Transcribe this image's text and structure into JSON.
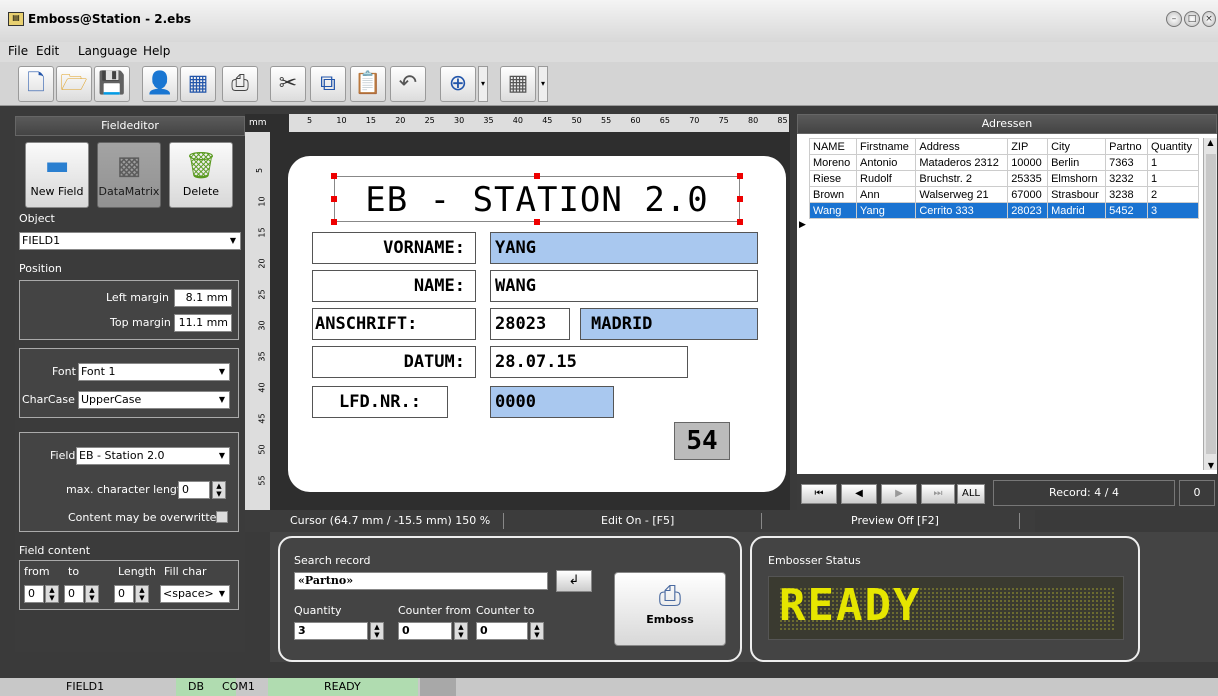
{
  "window": {
    "title": "Emboss@Station - 2.ebs"
  },
  "menu": [
    "File",
    "Edit",
    "Language",
    "Help"
  ],
  "toolbar": {
    "icons": [
      "new-file-icon",
      "open-folder-icon",
      "save-icon",
      "user-settings-icon",
      "preview-icon",
      "print-icon",
      "cut-icon",
      "copy-icon",
      "paste-icon",
      "undo-icon",
      "zoom-icon",
      "grid-icon"
    ]
  },
  "fieldeditor": {
    "header": "Fieldeditor",
    "new_field": "New Field",
    "datamatrix": "DataMatrix",
    "delete": "Delete",
    "object_label": "Object",
    "object_value": "FIELD1",
    "position_label": "Position",
    "left_margin_label": "Left margin",
    "left_margin": "8.1 mm",
    "top_margin_label": "Top margin",
    "top_margin": "11.1 mm",
    "font_label": "Font",
    "font_value": "Font 1",
    "charcase_label": "CharCase",
    "charcase_value": "UpperCase",
    "field_label": "Field",
    "field_value": "EB - Station 2.0",
    "maxlen_label": "max. character length",
    "maxlen_value": "0",
    "overwrite_label": "Content may be overwritten",
    "content_label": "Field content",
    "from_label": "from",
    "to_label": "to",
    "length_label": "Length",
    "fill_label": "Fill char",
    "from_value": "0",
    "to_value": "0",
    "length_value": "0",
    "fill_value": "<space>"
  },
  "ruler": {
    "unit": "mm",
    "ticks": [
      "5",
      "10",
      "15",
      "20",
      "25",
      "30",
      "35",
      "40",
      "45",
      "50",
      "55",
      "60",
      "65",
      "70",
      "75",
      "80",
      "85"
    ],
    "vticks": [
      "5",
      "10",
      "15",
      "20",
      "25",
      "30",
      "35",
      "40",
      "45",
      "50",
      "55"
    ]
  },
  "card": {
    "title": "EB - STATION 2.0",
    "rows": [
      {
        "label": "VORNAME:",
        "value": "YANG"
      },
      {
        "label": "NAME:",
        "value": "WANG"
      },
      {
        "label": "ANSCHRIFT:",
        "value": "28023",
        "value2": "MADRID"
      },
      {
        "label": "DATUM:",
        "value": "28.07.15"
      },
      {
        "label": "LFD.NR.:",
        "value": "0000"
      }
    ],
    "number": "54"
  },
  "status": {
    "cursor": "Cursor (64.7 mm / -15.5 mm) 150 %",
    "edit": "Edit On - [F5]",
    "preview": "Preview Off [F2]"
  },
  "addresses": {
    "header": "Adressen",
    "columns": [
      "NAME",
      "Firstname",
      "Address",
      "ZIP",
      "City",
      "Partno",
      "Quantity"
    ],
    "rows": [
      [
        "Moreno",
        "Antonio",
        "Mataderos 2312",
        "10000",
        "Berlin",
        "7363",
        "1"
      ],
      [
        "Riese",
        "Rudolf",
        "Bruchstr. 2",
        "25335",
        "Elmshorn",
        "3232",
        "1"
      ],
      [
        "Brown",
        "Ann",
        "Walserweg 21",
        "67000",
        "Strasbour",
        "3238",
        "2"
      ],
      [
        "Wang",
        "Yang",
        "Cerrito 333",
        "28023",
        "Madrid",
        "5452",
        "3"
      ]
    ],
    "all": "ALL",
    "record": "Record: 4 / 4",
    "count": "0"
  },
  "search": {
    "label": "Search record",
    "value": "«Partno»",
    "quantity_label": "Quantity",
    "quantity": "3",
    "counter_from_label": "Counter from",
    "counter_from": "0",
    "counter_to_label": "Counter to",
    "counter_to": "0",
    "emboss": "Emboss"
  },
  "embosser": {
    "label": "Embosser Status",
    "status": "READY",
    "color": "#e6e600"
  },
  "statusbar": {
    "field": "FIELD1",
    "db": "DB",
    "port": "COM1",
    "state": "READY"
  }
}
